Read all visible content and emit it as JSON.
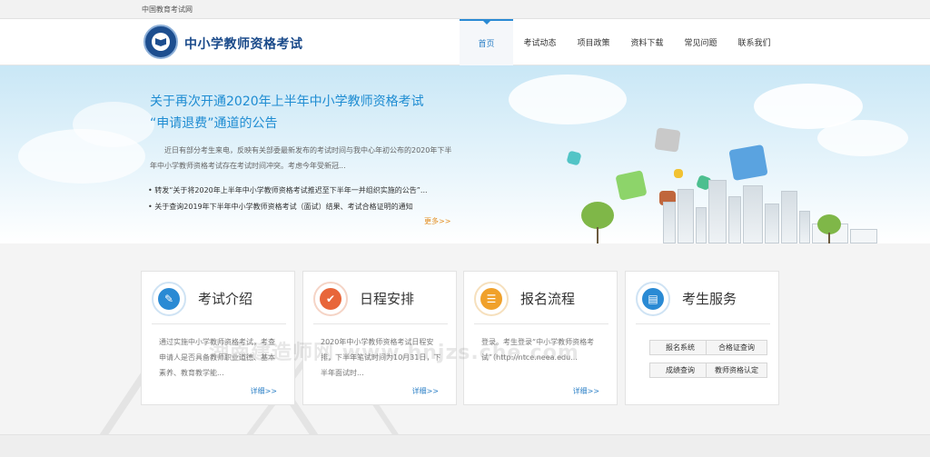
{
  "topbar": {
    "site_name": "中国教育考试网"
  },
  "header": {
    "logo_text": "中小学教师资格考试",
    "nav": [
      {
        "label": "首页",
        "active": true
      },
      {
        "label": "考试动态"
      },
      {
        "label": "项目政策"
      },
      {
        "label": "资料下载"
      },
      {
        "label": "常见问题"
      },
      {
        "label": "联系我们"
      }
    ]
  },
  "banner": {
    "headline_line1": "关于再次开通2020年上半年中小学教师资格考试",
    "headline_line2": "“申请退费”通道的公告",
    "summary": "近日有部分考生来电，反映有关部委最新发布的考试时间与我中心年初公布的2020年下半年中小学教师资格考试存在考试时间冲突。考虑今年受新冠...",
    "news": [
      "转发“关于将2020年上半年中小学教师资格考试推迟至下半年一并组织实施的公告”...",
      "关于查询2019年下半年中小学教师资格考试（面试）结果、考试合格证明的通知"
    ],
    "more_label": "更多>>"
  },
  "cards": [
    {
      "title": "考试介绍",
      "icon": "pen-icon",
      "color": "#2a8ad4",
      "desc": "通过实施中小学教师资格考试，考查申请人是否具备教师职业道德、基本素养、教育教学能...",
      "more": "详细>>"
    },
    {
      "title": "日程安排",
      "icon": "checkmark-icon",
      "color": "#e8663a",
      "desc": "2020年中小学教师资格考试日程安排，下半年笔试时间为10月31日，下半年面试时...",
      "more": "详细>>"
    },
    {
      "title": "报名流程",
      "icon": "form-icon",
      "color": "#f0a12b",
      "desc": "登录。考生登录“中小学教师资格考试”（http://ntce.neea.edu...",
      "more": "详细>>"
    },
    {
      "title": "考生服务",
      "icon": "id-card-icon",
      "color": "#2a8ad4",
      "buttons": [
        "报名系统",
        "合格证查询",
        "成绩查询",
        "教师资格认定"
      ]
    }
  ],
  "watermark": "湖南建造师网 www.hnjzs.che.com"
}
